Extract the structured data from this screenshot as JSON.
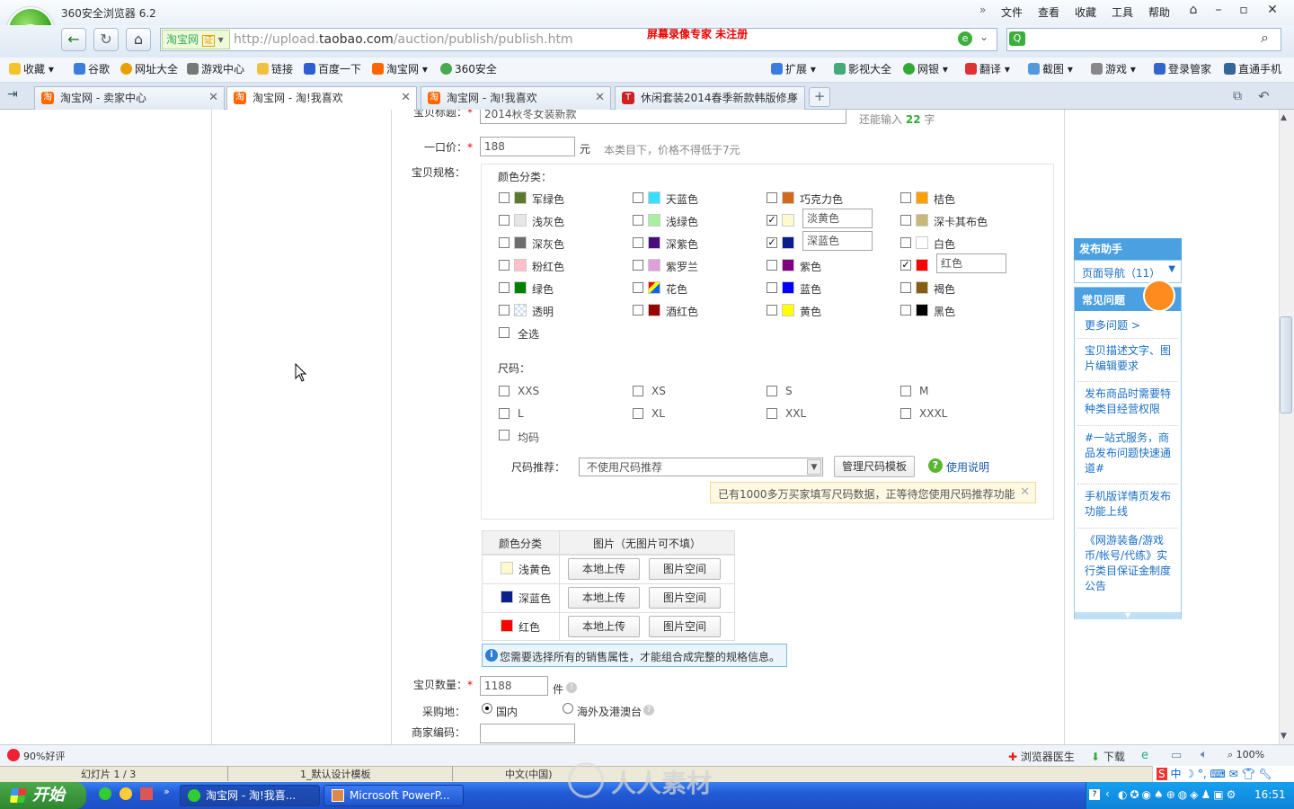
{
  "browser": {
    "title": "360安全浏览器 6.2",
    "menu": [
      "文件",
      "查看",
      "收藏",
      "工具",
      "帮助"
    ],
    "site_tag": "淘宝网",
    "site_cert": "证",
    "url_prefix": "http://upload.",
    "url_domain": "taobao.com",
    "url_path": "/auction/publish/publish.htm",
    "recorder_watermark": "屏幕录像专家  未注册",
    "favorites": [
      "收藏",
      "谷歌",
      "网址大全",
      "游戏中心",
      "链接",
      "百度一下",
      "淘宝网",
      "360安全"
    ],
    "favorites_right": [
      "扩展",
      "影视大全",
      "网银",
      "翻译",
      "截图",
      "游戏",
      "登录管家",
      "直通手机"
    ],
    "tabs": [
      "淘宝网 - 卖家中心",
      "淘宝网 - 淘!我喜欢",
      "淘宝网 - 淘!我喜欢",
      "休闲套装2014春季新款韩版修身"
    ],
    "status_left": "90%好评",
    "status_right": [
      "浏览器医生",
      "下载",
      "100%"
    ]
  },
  "form": {
    "title_label": "宝贝标题：",
    "title_value": "2014秋冬女装新款",
    "title_remaining_prefix": "还能输入",
    "title_remaining_count": "22",
    "title_remaining_suffix": "字",
    "price_label": "一口价：",
    "price_value": "188",
    "price_unit": "元",
    "price_hint": "本类目下，价格不得低于7元",
    "spec_label": "宝贝规格：",
    "color_section": "颜色分类：",
    "colors": [
      {
        "name": "军绿色",
        "hex": "#5b7a2e",
        "checked": false
      },
      {
        "name": "天蓝色",
        "hex": "#33e0ff",
        "checked": false
      },
      {
        "name": "巧克力色",
        "hex": "#d2691e",
        "checked": false
      },
      {
        "name": "桔色",
        "hex": "#ffa000",
        "checked": false
      },
      {
        "name": "浅灰色",
        "hex": "#e6e6e6",
        "checked": false
      },
      {
        "name": "浅绿色",
        "hex": "#a8f0a0",
        "checked": false
      },
      {
        "name": "淡黄色",
        "hex": "#fffacd",
        "checked": true,
        "custom": "淡黄色"
      },
      {
        "name": "深卡其布色",
        "hex": "#c8b878",
        "checked": false
      },
      {
        "name": "深灰色",
        "hex": "#6e6e6e",
        "checked": false
      },
      {
        "name": "深紫色",
        "hex": "#4b0f7a",
        "checked": false
      },
      {
        "name": "深蓝色",
        "hex": "#0a1e8c",
        "checked": true,
        "custom": "深蓝色"
      },
      {
        "name": "白色",
        "hex": "#ffffff",
        "checked": false
      },
      {
        "name": "粉红色",
        "hex": "#ffc0cb",
        "checked": false
      },
      {
        "name": "紫罗兰",
        "hex": "#dda0dd",
        "checked": false
      },
      {
        "name": "紫色",
        "hex": "#800080",
        "checked": false
      },
      {
        "name": "红色",
        "hex": "#ff0000",
        "checked": true,
        "custom": "红色"
      },
      {
        "name": "绿色",
        "hex": "#008000",
        "checked": false
      },
      {
        "name": "花色",
        "hex": "#ff8800",
        "checked": false
      },
      {
        "name": "蓝色",
        "hex": "#0000ff",
        "checked": false
      },
      {
        "name": "褐色",
        "hex": "#855e10",
        "checked": false
      },
      {
        "name": "透明",
        "hex": "#d8e4f4",
        "checked": false
      },
      {
        "name": "酒红色",
        "hex": "#990000",
        "checked": false
      },
      {
        "name": "黄色",
        "hex": "#ffff00",
        "checked": false
      },
      {
        "name": "黑色",
        "hex": "#000000",
        "checked": false
      }
    ],
    "select_all": "全选",
    "size_section": "尺码：",
    "sizes": [
      "XXS",
      "XS",
      "S",
      "M",
      "L",
      "XL",
      "XXL",
      "XXXL",
      "均码"
    ],
    "size_rec_label": "尺码推荐：",
    "size_rec_value": "不使用尺码推荐",
    "size_manage_button": "管理尺码模板",
    "size_help": "使用说明",
    "size_notice": "已有1000多万买家填写尺码数据，正等待您使用尺码推荐功能",
    "img_table": {
      "headers": [
        "颜色分类",
        "图片（无图片可不填）"
      ],
      "rows": [
        {
          "name": "浅黄色",
          "hex": "#fffacd"
        },
        {
          "name": "深蓝色",
          "hex": "#0a1e8c"
        },
        {
          "name": "红色",
          "hex": "#ff0000"
        }
      ],
      "upload_button": "本地上传",
      "space_button": "图片空间"
    },
    "spec_info": "您需要选择所有的销售属性，才能组合成完整的规格信息。",
    "qty_label": "宝贝数量：",
    "qty_value": "1188",
    "qty_unit": "件",
    "origin_label": "采购地：",
    "origin_domestic": "国内",
    "origin_overseas": "海外及港澳台",
    "code_label": "商家编码："
  },
  "helper": {
    "title": "发布助手",
    "nav": "页面导航（11）",
    "faq_title": "常见问题",
    "more": "更多问题 >",
    "items": [
      "宝贝描述文字、图片编辑要求",
      "发布商品时需要特种类目经营权限",
      "#一站式服务，商品发布问题快速通道#",
      "手机版详情页发布功能上线",
      "《网游装备/游戏币/帐号/代练》实行类目保证金制度公告"
    ]
  },
  "ppt": {
    "slide": "幻灯片 1 / 3",
    "template": "1_默认设计模板",
    "lang": "中文(中国)"
  },
  "taskbar": {
    "start": "开始",
    "tasks": [
      "淘宝网 - 淘!我喜...",
      "Microsoft PowerP..."
    ],
    "watermark": "人人素材",
    "clock": "16:51"
  }
}
